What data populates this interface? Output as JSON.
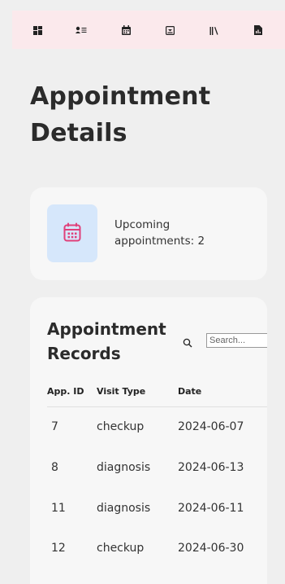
{
  "nav": {
    "items": [
      {
        "icon": "dashboard-icon"
      },
      {
        "icon": "patients-list-icon"
      },
      {
        "icon": "calendar-icon"
      },
      {
        "icon": "inbox-icon"
      },
      {
        "icon": "library-icon"
      },
      {
        "icon": "report-document-icon"
      }
    ]
  },
  "page": {
    "title": "Appointment Details"
  },
  "summary": {
    "text": "Upcoming appointments: 2",
    "icon": "calendar-icon",
    "icon_color": "#e0407a",
    "icon_bg": "#d6e7fb"
  },
  "records": {
    "title": "Appointment Records",
    "search_placeholder": "Search...",
    "columns": [
      "App. ID",
      "Visit Type",
      "Date"
    ],
    "rows": [
      {
        "id": "7",
        "type": "checkup",
        "date": "2024-06-07"
      },
      {
        "id": "8",
        "type": "diagnosis",
        "date": "2024-06-13"
      },
      {
        "id": "11",
        "type": "diagnosis",
        "date": "2024-06-11"
      },
      {
        "id": "12",
        "type": "checkup",
        "date": "2024-06-30"
      }
    ]
  },
  "colors": {
    "topbar_bg": "#fbe9ec",
    "page_bg": "#efefef",
    "card_bg": "#f7f7f7"
  }
}
